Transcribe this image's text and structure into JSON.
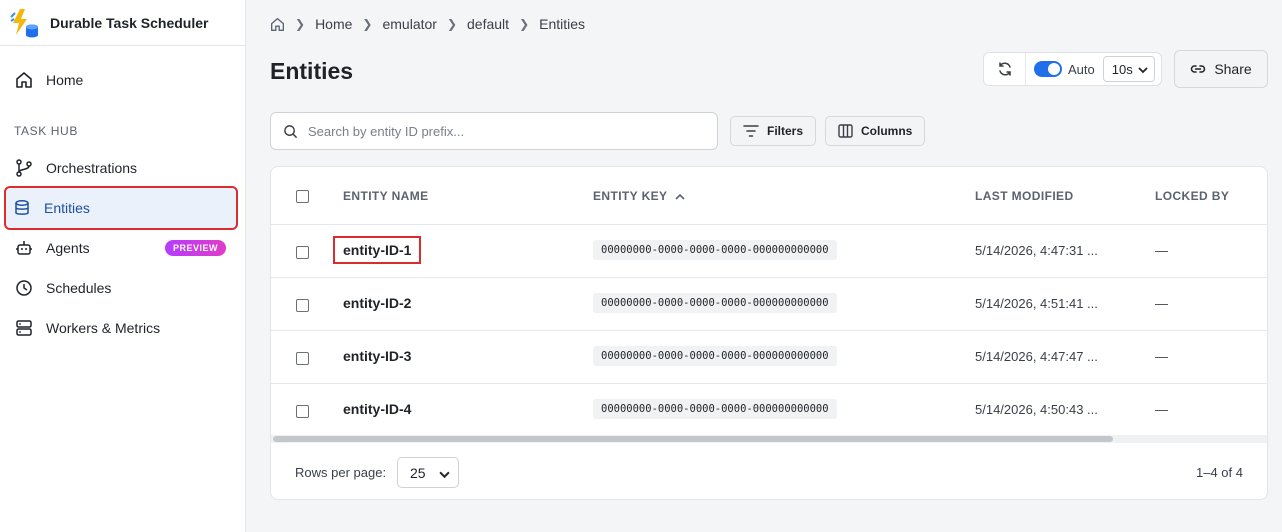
{
  "app": {
    "title": "Durable Task Scheduler"
  },
  "sidebar": {
    "home_label": "Home",
    "section_label": "TASK HUB",
    "items": [
      {
        "label": "Orchestrations",
        "icon": "branch-icon"
      },
      {
        "label": "Entities",
        "icon": "database-icon",
        "active": true
      },
      {
        "label": "Agents",
        "icon": "robot-icon",
        "badge": "PREVIEW"
      },
      {
        "label": "Schedules",
        "icon": "clock-icon"
      },
      {
        "label": "Workers & Metrics",
        "icon": "server-icon"
      }
    ]
  },
  "breadcrumb": [
    "emulator",
    "default",
    "Entities"
  ],
  "breadcrumb_home": "Home",
  "page": {
    "title": "Entities"
  },
  "refresh": {
    "auto_label": "Auto",
    "interval": "10s",
    "auto_enabled": true
  },
  "share": {
    "label": "Share"
  },
  "search": {
    "placeholder": "Search by entity ID prefix..."
  },
  "toolbar": {
    "filters_label": "Filters",
    "columns_label": "Columns"
  },
  "table": {
    "columns": [
      "ENTITY NAME",
      "ENTITY KEY",
      "LAST MODIFIED",
      "LOCKED BY"
    ],
    "sort_column": "ENTITY KEY",
    "sort_direction": "ascending",
    "rows": [
      {
        "name": "entity-ID-1",
        "key": "00000000-0000-0000-0000-000000000000",
        "modified": "5/14/2026, 4:47:31 ...",
        "locked": "—"
      },
      {
        "name": "entity-ID-2",
        "key": "00000000-0000-0000-0000-000000000000",
        "modified": "5/14/2026, 4:51:41 ...",
        "locked": "—"
      },
      {
        "name": "entity-ID-3",
        "key": "00000000-0000-0000-0000-000000000000",
        "modified": "5/14/2026, 4:47:47 ...",
        "locked": "—"
      },
      {
        "name": "entity-ID-4",
        "key": "00000000-0000-0000-0000-000000000000",
        "modified": "5/14/2026, 4:50:43 ...",
        "locked": "—"
      }
    ]
  },
  "pagination": {
    "rows_per_page_label": "Rows per page:",
    "rows_per_page": "25",
    "range": "1–4 of 4"
  },
  "colors": {
    "accent": "#1f6feb",
    "highlight": "#d92c2c",
    "active_bg": "#eaf1fb",
    "badge": "#c83ce8"
  }
}
